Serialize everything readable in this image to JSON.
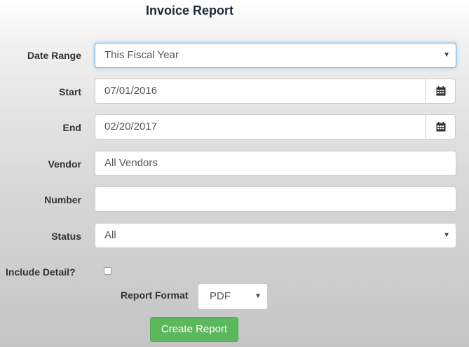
{
  "report": {
    "title": "Invoice Report"
  },
  "form": {
    "date_range": {
      "label": "Date Range",
      "selected": "This Fiscal Year"
    },
    "start": {
      "label": "Start",
      "value": "07/01/2016"
    },
    "end": {
      "label": "End",
      "value": "02/20/2017"
    },
    "vendor": {
      "label": "Vendor",
      "value": "All Vendors"
    },
    "number": {
      "label": "Number",
      "value": ""
    },
    "status": {
      "label": "Status",
      "selected": "All"
    },
    "include_detail": {
      "label": "Include Detail?",
      "checked": false
    },
    "report_format": {
      "label": "Report Format",
      "selected": "PDF"
    },
    "submit_label": "Create Report"
  },
  "icons": {
    "calendar": "calendar-icon",
    "caret": "caret-down-icon",
    "caret_glyph": "▼"
  },
  "colors": {
    "primary_button": "#5cb85c",
    "focus_border": "#66afe9",
    "title": "#1a2a3a"
  }
}
